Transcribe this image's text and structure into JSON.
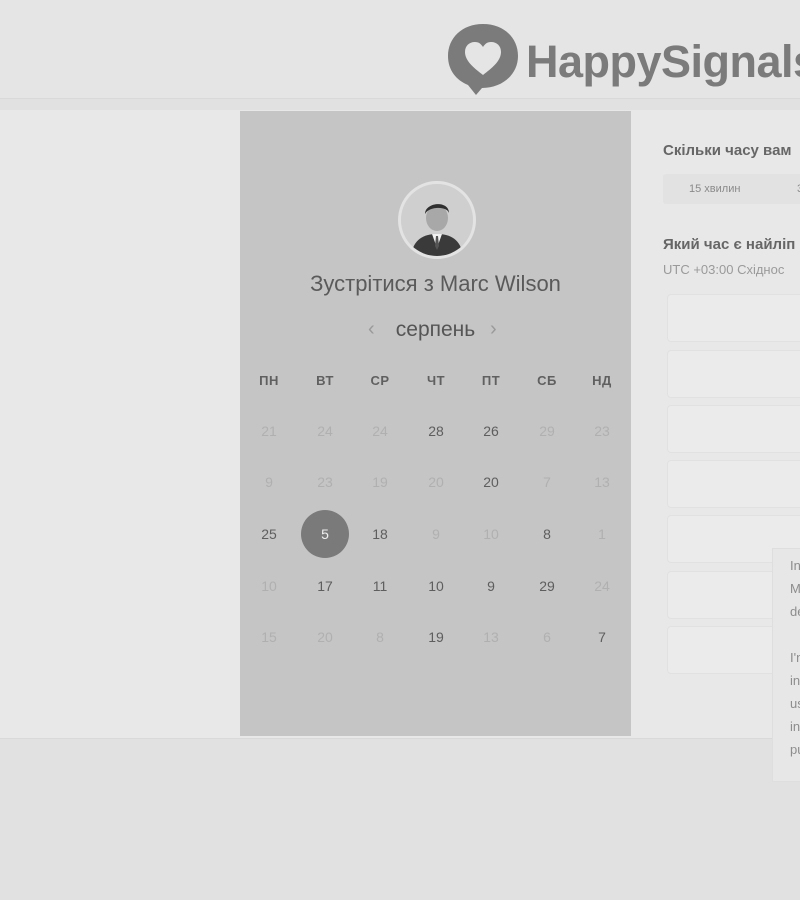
{
  "brand": {
    "name": "HappySignals",
    "logo_icon": "heart-speech-bubble-icon"
  },
  "calendar": {
    "title": "Зустрітися з Marc Wilson",
    "month": "серпень",
    "prev_icon": "chevron-left-icon",
    "next_icon": "chevron-right-icon",
    "weekdays": [
      "ПН",
      "ВТ",
      "СР",
      "ЧТ",
      "ПТ",
      "СБ",
      "НД"
    ],
    "rows": [
      [
        {
          "d": "21",
          "f": true
        },
        {
          "d": "24",
          "f": true
        },
        {
          "d": "24",
          "f": true
        },
        {
          "d": "28",
          "f": false
        },
        {
          "d": "26",
          "f": false
        },
        {
          "d": "29",
          "f": true
        },
        {
          "d": "23",
          "f": true
        }
      ],
      [
        {
          "d": "9",
          "f": true
        },
        {
          "d": "23",
          "f": true
        },
        {
          "d": "19",
          "f": true
        },
        {
          "d": "20",
          "f": true
        },
        {
          "d": "20",
          "f": false
        },
        {
          "d": "7",
          "f": true
        },
        {
          "d": "13",
          "f": true
        }
      ],
      [
        {
          "d": "25",
          "f": false
        },
        {
          "d": "5",
          "f": false,
          "s": true
        },
        {
          "d": "18",
          "f": false
        },
        {
          "d": "9",
          "f": true
        },
        {
          "d": "10",
          "f": true
        },
        {
          "d": "8",
          "f": false
        },
        {
          "d": "1",
          "f": true
        }
      ],
      [
        {
          "d": "10",
          "f": true
        },
        {
          "d": "17",
          "f": false
        },
        {
          "d": "11",
          "f": false
        },
        {
          "d": "10",
          "f": false
        },
        {
          "d": "9",
          "f": false
        },
        {
          "d": "29",
          "f": false
        },
        {
          "d": "24",
          "f": true
        }
      ],
      [
        {
          "d": "15",
          "f": true
        },
        {
          "d": "20",
          "f": true
        },
        {
          "d": "8",
          "f": true
        },
        {
          "d": "19",
          "f": false
        },
        {
          "d": "13",
          "f": true
        },
        {
          "d": "6",
          "f": true
        },
        {
          "d": "7",
          "f": false
        }
      ]
    ]
  },
  "booking": {
    "duration_question": "Скільки часу вам",
    "durations": [
      "15 хвилин",
      "3"
    ],
    "time_question": "Який час є найліп",
    "timezone": "UTC +03:00 Східнос"
  },
  "note_lines": [
    "In",
    "M",
    "de",
    "I'n",
    "in",
    "us",
    "in",
    "pu"
  ]
}
